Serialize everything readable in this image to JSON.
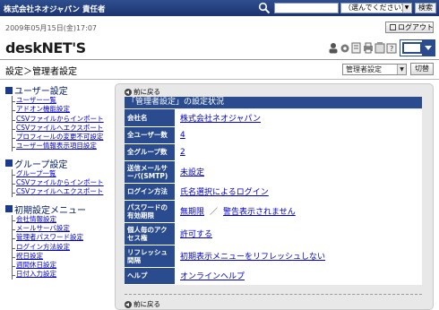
{
  "header": {
    "company_role": "株式会社ネオジャパン 責任者",
    "scope_value": "（選んでください）",
    "search_label": "検索"
  },
  "datetime": "2009年05月15日(金)17:07",
  "logout_label": "ログアウト",
  "logo": {
    "desk": "desk",
    "net": "NET'S"
  },
  "page_title": "設定＞管理者設定",
  "role_select_value": "管理者設定",
  "switch_label": "切替",
  "sidebar": {
    "sections": [
      {
        "title": "ユーザー設定",
        "items": [
          "ユーザー一覧",
          "アドオン機能設定",
          "CSVファイルからインポート",
          "CSVファイルへエクスポート",
          "プロフィールの変更不可設定",
          "ユーザー情報表示項目設定"
        ]
      },
      {
        "title": "グループ設定",
        "items": [
          "グループ一覧",
          "CSVファイルからインポート",
          "CSVファイルへエクスポート"
        ]
      },
      {
        "title": "初期設定メニュー",
        "items": [
          "会社情報設定",
          "メールサーバ設定",
          "管理者パスワード設定",
          "ログイン方法設定",
          "祝日設定",
          "週間休日設定",
          "日付入力設定"
        ]
      }
    ]
  },
  "main": {
    "back_label": "前に戻る",
    "heading": "「管理者設定」の設定状況",
    "rows": [
      {
        "key": "会社名",
        "value": "株式会社ネオジャパン"
      },
      {
        "key": "全ユーザー数",
        "value": "4"
      },
      {
        "key": "全グループ数",
        "value": "2"
      },
      {
        "key": "送信メールサーバ(SMTP)",
        "value": "未設定"
      },
      {
        "key": "ログイン方法",
        "value": "氏名選択によるログイン"
      },
      {
        "key": "パスワードの有効期限",
        "value": "無期限",
        "value2": "警告表示されません",
        "sep": "／"
      },
      {
        "key": "個人毎のアクセス権",
        "value": "許可する"
      },
      {
        "key": "リフレッシュ間隔",
        "value": "初期表示メニューをリフレッシュしない"
      },
      {
        "key": "ヘルプ",
        "value": "オンラインヘルプ"
      }
    ]
  },
  "colors": {
    "primary": "#2a4c8f",
    "topbar": "#1d3470",
    "panel_bg": "#e8e8e8"
  }
}
